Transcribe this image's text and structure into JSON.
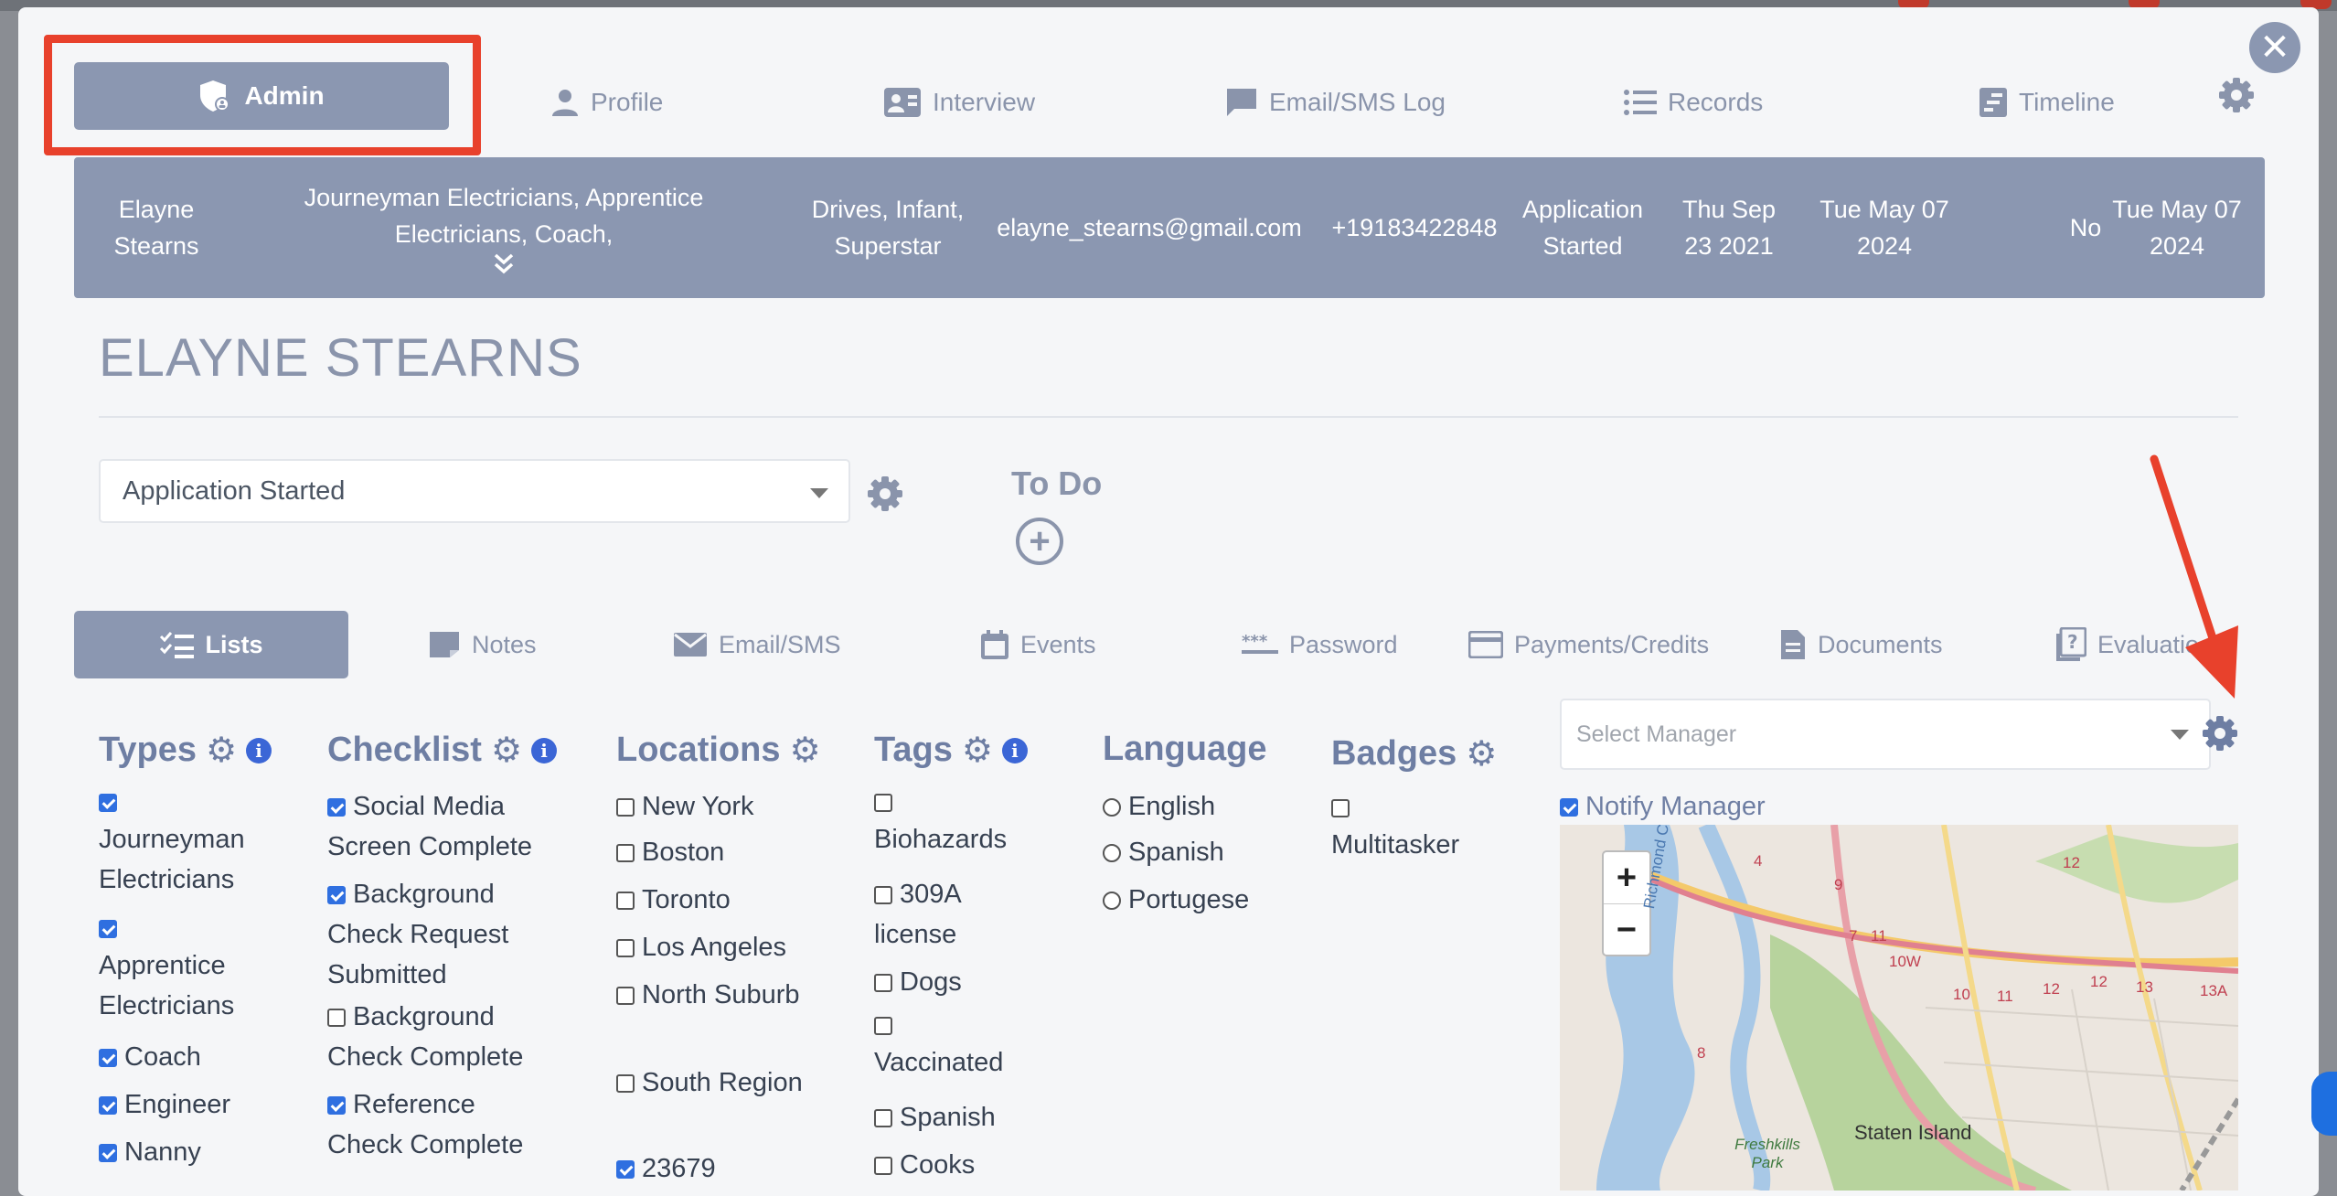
{
  "nav": {
    "admin": "Admin",
    "profile": "Profile",
    "interview": "Interview",
    "log": "Email/SMS Log",
    "records": "Records",
    "timeline": "Timeline"
  },
  "band": {
    "name": "Elayne Stearns",
    "types_line1": "Journeyman Electricians, Apprentice",
    "types_line2": "Electricians, Coach,",
    "tags": "Drives, Infant, Superstar",
    "email": "elayne_stearns@gmail.com",
    "phone": "+19183422848",
    "status": "Application Started",
    "date1": "Thu Sep 23 2021",
    "date2": "Tue May 07 2024",
    "flag": "No",
    "date3": "Tue May 07 2024"
  },
  "profile_title": "ELAYNE STEARNS",
  "status_select": "Application Started",
  "todo": "To Do",
  "subtabs": {
    "lists": "Lists",
    "notes": "Notes",
    "email": "Email/SMS",
    "events": "Events",
    "password": "Password",
    "payments": "Payments/Credits",
    "documents": "Documents",
    "evaluation": "Evaluatio"
  },
  "types": {
    "title": "Types",
    "items": [
      "Journeyman Electricians",
      "Apprentice Electricians",
      "Coach",
      "Engineer",
      "Nanny"
    ],
    "checked": [
      true,
      true,
      true,
      true,
      true
    ]
  },
  "checklist": {
    "title": "Checklist",
    "items": [
      "Social Media Screen Complete",
      "Background Check Request Submitted",
      "Background Check Complete",
      "Reference Check Complete"
    ],
    "checked": [
      true,
      true,
      false,
      true
    ]
  },
  "locations": {
    "title": "Locations",
    "items": [
      "New York",
      "Boston",
      "Toronto",
      "Los Angeles",
      "North Suburb",
      "South Region",
      "23679"
    ],
    "checked": [
      false,
      false,
      false,
      false,
      false,
      false,
      true
    ]
  },
  "tags": {
    "title": "Tags",
    "items": [
      "Biohazards",
      "309A license",
      "Dogs",
      "Vaccinated",
      "Spanish",
      "Cooks"
    ],
    "checked": [
      false,
      false,
      false,
      false,
      false,
      false
    ]
  },
  "language": {
    "title": "Language",
    "items": [
      "English",
      "Spanish",
      "Portugese"
    ]
  },
  "badges": {
    "title": "Badges",
    "items": [
      "Multitasker"
    ]
  },
  "manager": {
    "placeholder": "Select Manager",
    "notify": "Notify Manager"
  },
  "map": {
    "label_city": "Staten Island",
    "label_park": "Freshkills Park",
    "label_river": "Richmond Creek",
    "routes": [
      "4",
      "9",
      "7",
      "11",
      "10W",
      "10",
      "11",
      "12",
      "12",
      "13",
      "13A",
      "8",
      "12"
    ]
  }
}
